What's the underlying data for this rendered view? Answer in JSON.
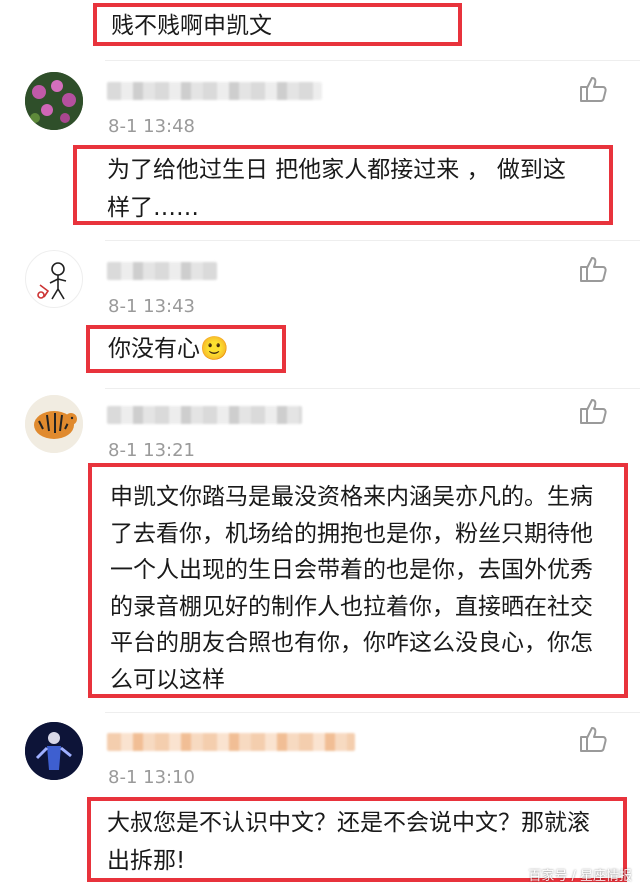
{
  "comments": [
    {
      "text": "贱不贱啊申凯文"
    },
    {
      "time": "8-1 13:48",
      "text": "为了给他过生日 把他家人都接过来 ， 做到这样了……"
    },
    {
      "time": "8-1 13:43",
      "text": "你没有心🙂"
    },
    {
      "time": "8-1 13:21",
      "text": "申凯文你踏马是最没资格来内涵吴亦凡的。生病了去看你，机场给的拥抱也是你，粉丝只期待他一个人出现的生日会带着的也是你，去国外优秀的录音棚见好的制作人也拉着你，直接晒在社交平台的朋友合照也有你，你咋这么没良心，你怎么可以这样"
    },
    {
      "time": "8-1 13:10",
      "text": "大叔您是不认识中文？还是不会说中文？那就滚出拆那!"
    }
  ],
  "icons": {
    "like": "thumbs-up-icon"
  },
  "colors": {
    "highlight_box": "#e8333c",
    "timestamp": "#9a9a9a"
  },
  "watermark": "百家号 / 星座情报"
}
